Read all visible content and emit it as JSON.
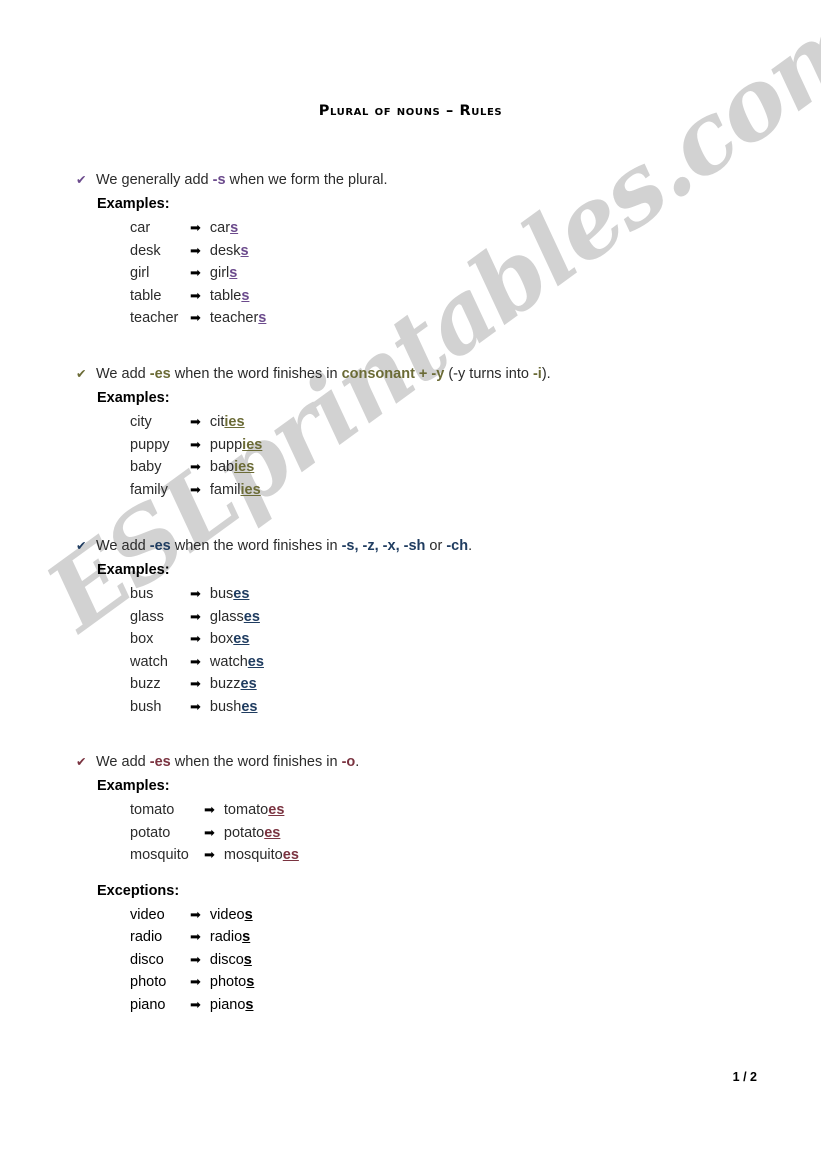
{
  "document": {
    "title": "Plural of nouns – Rules",
    "page_number": "1 / 2",
    "watermark": "ESLprintables.com",
    "watermark_color": "#d2d2d2",
    "arrow_glyph": "➡",
    "check_glyph": "✔"
  },
  "labels": {
    "examples": "Examples:",
    "exceptions": "Exceptions:"
  },
  "rules": [
    {
      "color": "#6b4a8c",
      "text_pre": "We generally add ",
      "text_bold": "-s",
      "text_post": " when we form the plural.",
      "examples_label": "Examples:",
      "examples": [
        {
          "singular": "car",
          "stem": "car",
          "ending": "s"
        },
        {
          "singular": "desk",
          "stem": "desk",
          "ending": "s"
        },
        {
          "singular": "girl",
          "stem": "girl",
          "ending": "s"
        },
        {
          "singular": "table",
          "stem": "table",
          "ending": "s"
        },
        {
          "singular": "teacher",
          "stem": "teacher",
          "ending": "s"
        }
      ]
    },
    {
      "color": "#6b6b36",
      "text_pre": "We add ",
      "text_bold": "-es",
      "text_mid": " when the word finishes in ",
      "text_bold2": "consonant + -y",
      "text_mid2": " (-y turns into ",
      "text_bold3": "-i",
      "text_post": ").",
      "examples_label": "Examples:",
      "examples": [
        {
          "singular": "city",
          "stem": "cit",
          "ending": "ies"
        },
        {
          "singular": "puppy",
          "stem": "pupp",
          "ending": "ies"
        },
        {
          "singular": "baby",
          "stem": "bab",
          "ending": "ies"
        },
        {
          "singular": "family",
          "stem": "famil",
          "ending": "ies"
        }
      ]
    },
    {
      "color": "#1f3c60",
      "text_pre": "We add ",
      "text_bold": "-es",
      "text_mid": " when the word finishes in ",
      "endings_list": "-s, -z, -x, -sh",
      "text_or": " or ",
      "text_bold3": "-ch",
      "text_post": ".",
      "examples_label": "Examples:",
      "examples": [
        {
          "singular": "bus",
          "stem": "bus",
          "ending": "es"
        },
        {
          "singular": "glass",
          "stem": "glass",
          "ending": "es"
        },
        {
          "singular": "box",
          "stem": "box",
          "ending": "es"
        },
        {
          "singular": "watch",
          "stem": "watch",
          "ending": "es"
        },
        {
          "singular": "buzz",
          "stem": "buzz",
          "ending": "es"
        },
        {
          "singular": "bush",
          "stem": "bush",
          "ending": "es"
        }
      ]
    },
    {
      "color": "#7a3340",
      "text_pre": "We add ",
      "text_bold": "-es",
      "text_mid": " when the word finishes in ",
      "text_bold3": "-o",
      "text_post": ".",
      "examples_label": "Examples:",
      "examples": [
        {
          "singular": "tomato",
          "stem": "tomato",
          "ending": "es"
        },
        {
          "singular": "potato",
          "stem": "potato",
          "ending": "es"
        },
        {
          "singular": "mosquito",
          "stem": "mosquito",
          "ending": "es"
        }
      ],
      "exceptions_label": "Exceptions:",
      "exceptions_color": "#000000",
      "exceptions": [
        {
          "singular": "video",
          "stem": "video",
          "ending": "s"
        },
        {
          "singular": "radio",
          "stem": "radio",
          "ending": "s"
        },
        {
          "singular": "disco",
          "stem": "disco",
          "ending": "s"
        },
        {
          "singular": "photo",
          "stem": "photo",
          "ending": "s"
        },
        {
          "singular": "piano",
          "stem": "piano",
          "ending": "s"
        }
      ]
    }
  ]
}
